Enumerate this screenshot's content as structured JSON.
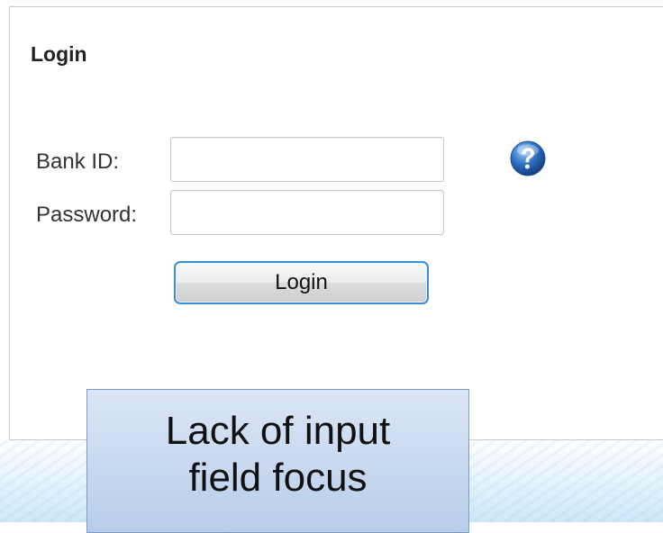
{
  "login_panel": {
    "title": "Login",
    "bank_id": {
      "label": "Bank ID:",
      "value": "",
      "placeholder": ""
    },
    "password": {
      "label": "Password:",
      "value": "",
      "placeholder": ""
    },
    "help_icon": "question-mark-help-icon",
    "login_button_label": "Login"
  },
  "callout": {
    "line1": "Lack of input",
    "line2": "field focus"
  },
  "colors": {
    "button_border": "#3b8fd4",
    "help_icon": "#2d6fc0",
    "callout_background": "#c6d9f1",
    "callout_border": "#7a9cc6"
  }
}
